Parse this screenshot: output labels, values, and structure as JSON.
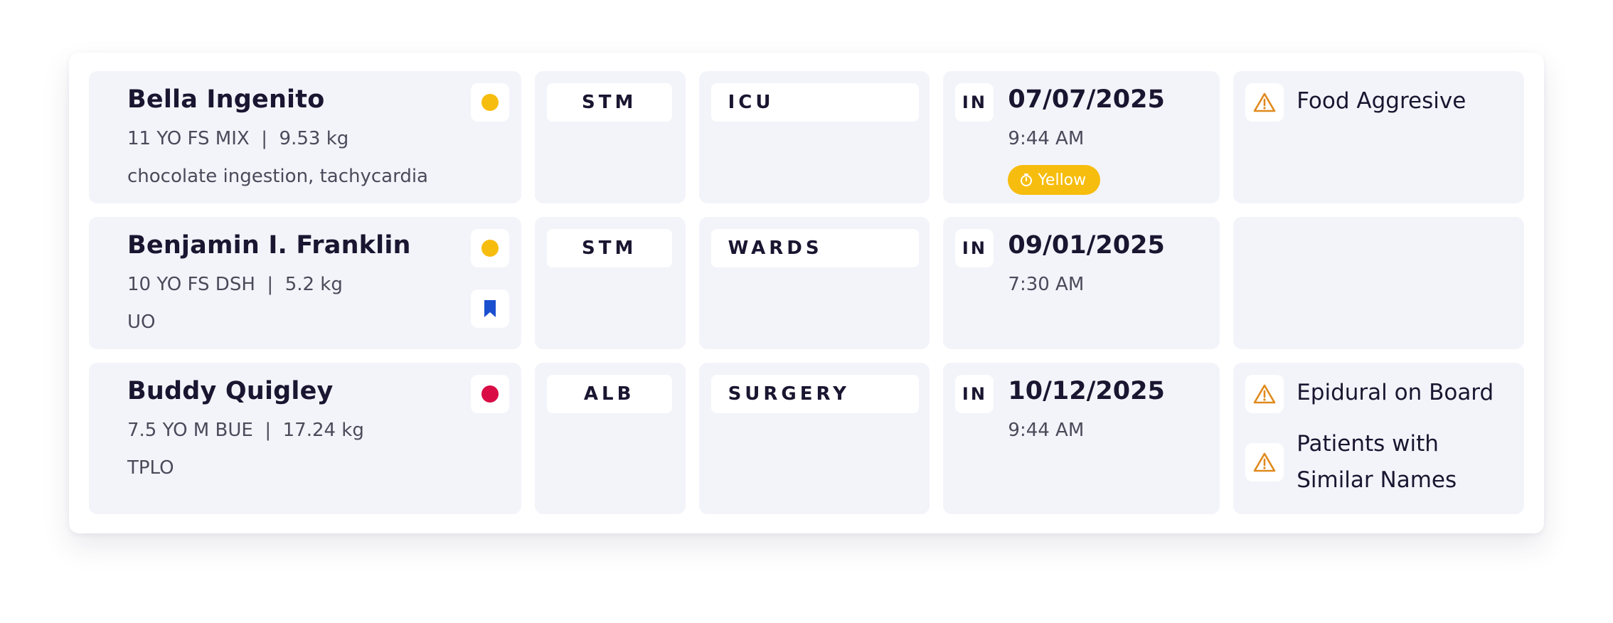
{
  "colors": {
    "card_bg": "#f3f4fa",
    "yellow": "#f7bd0e",
    "red": "#d90c45",
    "blue": "#1a4fcf",
    "warning_orange": "#e08a1e"
  },
  "patients": [
    {
      "name": "Bella Ingenito",
      "meta": "11 YO FS MIX  |  9.53 kg",
      "reason": "chocolate ingestion, tachycardia",
      "status_color": "yellow",
      "bookmarked": false,
      "location": "STM",
      "ward": "ICU",
      "direction": "IN",
      "date": "07/07/2025",
      "time": "9:44 AM",
      "badge": "Yellow",
      "alerts": [
        "Food Aggresive"
      ]
    },
    {
      "name": "Benjamin I. Franklin",
      "meta": "10 YO FS DSH  |  5.2 kg",
      "reason": "UO",
      "status_color": "yellow",
      "bookmarked": true,
      "location": "STM",
      "ward": "WARDS",
      "direction": "IN",
      "date": "09/01/2025",
      "time": "7:30 AM",
      "badge": null,
      "alerts": []
    },
    {
      "name": "Buddy Quigley",
      "meta": "7.5 YO M BUE  |  17.24 kg",
      "reason": "TPLO",
      "status_color": "red",
      "bookmarked": false,
      "location": "ALB",
      "ward": "SURGERY",
      "direction": "IN",
      "date": "10/12/2025",
      "time": "9:44 AM",
      "badge": null,
      "alerts": [
        "Epidural on Board",
        "Patients with Similar Names"
      ]
    }
  ]
}
